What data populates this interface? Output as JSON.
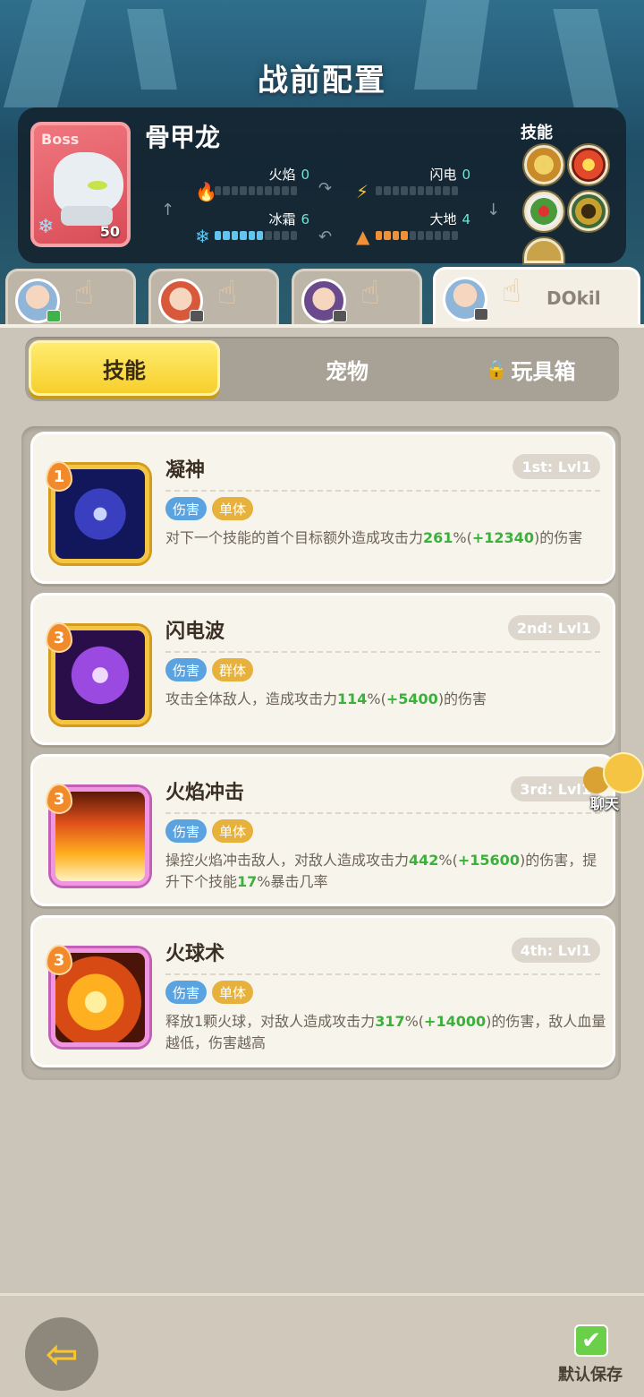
{
  "header": {
    "title": "战前配置"
  },
  "boss": {
    "tag": "Boss",
    "name": "骨甲龙",
    "level": "50",
    "elements": [
      {
        "label": "火焰",
        "value": "0",
        "icon": "fire-icon",
        "filled": 0,
        "segments": 10,
        "color": "#d94b3a"
      },
      {
        "label": "闪电",
        "value": "0",
        "icon": "lightning-icon",
        "filled": 0,
        "segments": 10,
        "color": "#f5c332"
      },
      {
        "label": "冰霜",
        "value": "6",
        "icon": "snowflake-icon",
        "filled": 6,
        "segments": 10,
        "color": "#61c5f0"
      },
      {
        "label": "大地",
        "value": "4",
        "icon": "earth-icon",
        "filled": 4,
        "segments": 10,
        "color": "#f09036"
      }
    ],
    "skills_label": "技能",
    "skill_icons": [
      "lion-skill-icon",
      "fire-swirl-skill-icon",
      "rose-skill-icon",
      "cloak-skill-icon",
      "shield-skill-icon"
    ]
  },
  "team_tabs": [
    {
      "avatar": "blue-hair-avatar",
      "name": "",
      "active": false
    },
    {
      "avatar": "red-hair-avatar",
      "name": "",
      "active": false
    },
    {
      "avatar": "purple-hair-avatar",
      "name": "",
      "active": false
    },
    {
      "avatar": "blue-hair-avatar",
      "name": "DOkil",
      "active": true
    }
  ],
  "segments": {
    "skills": "技能",
    "pets": "宠物",
    "toybox": "玩具箱"
  },
  "skills": [
    {
      "badge": "1",
      "name": "凝神",
      "slot": "1st: Lvl1",
      "tags": [
        "伤害",
        "单体"
      ],
      "desc_pre": "对下一个技能的首个目标额外造成攻击力",
      "hl1": "261",
      "pct1": "%(",
      "hl2": "+12340",
      "desc_post": ")的伤害",
      "icon": "focus-eye-icon"
    },
    {
      "badge": "3",
      "name": "闪电波",
      "slot": "2nd: Lvl1",
      "tags": [
        "伤害",
        "群体"
      ],
      "desc_pre": "攻击全体敌人，造成攻击力",
      "hl1": "114",
      "pct1": "%(",
      "hl2": "+5400",
      "desc_post": ")的伤害",
      "icon": "lightning-wave-icon"
    },
    {
      "badge": "3",
      "name": "火焰冲击",
      "slot": "3rd: Lvl1",
      "tags": [
        "伤害",
        "单体"
      ],
      "desc_pre": "操控火焰冲击敌人，对敌人造成攻击力",
      "hl1": "442",
      "pct1": "%(",
      "hl2": "+15600",
      "desc_post": ")的伤害，提升下个技能",
      "hl3": "17",
      "desc_tail": "%暴击几率",
      "icon": "flame-burst-icon"
    },
    {
      "badge": "3",
      "name": "火球术",
      "slot": "4th: Lvl1",
      "tags": [
        "伤害",
        "单体"
      ],
      "desc_pre": "释放1颗火球，对敌人造成攻击力",
      "hl1": "317",
      "pct1": "%(",
      "hl2": "+14000",
      "desc_post": ")的伤害，敌人血量越低，伤害越高",
      "icon": "fireball-icon"
    }
  ],
  "chat": {
    "label": "聊天"
  },
  "footer": {
    "save_label": "默认保存"
  }
}
